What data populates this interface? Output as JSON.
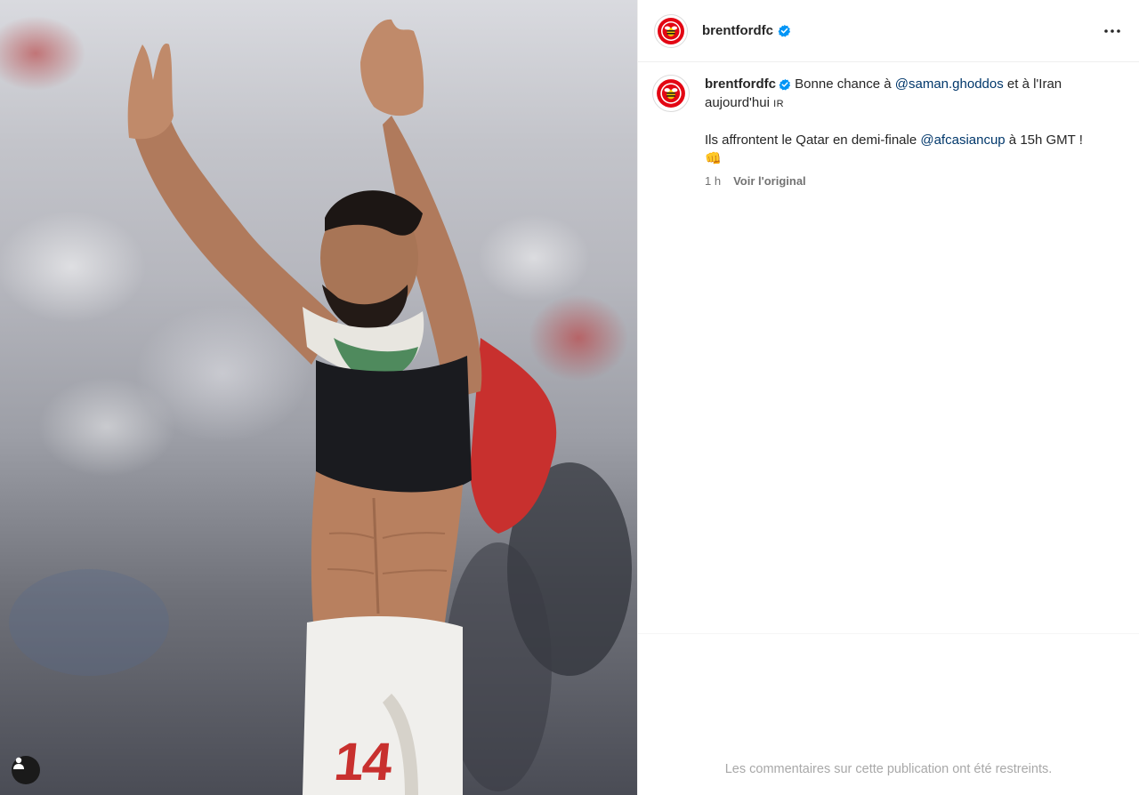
{
  "post": {
    "media_alt": "",
    "jersey_number": "14",
    "author": {
      "username": "brentfordfc",
      "verified": true,
      "avatar_icon": "brentford-bee-crest-icon"
    },
    "more_icon": "more-options-icon",
    "caption": {
      "username": "brentfordfc",
      "text_before": "Bonne chance à ",
      "mention_1": "@saman.ghoddos",
      "text_middle": " et à l'Iran aujourd'hui ",
      "flag": "IR",
      "line2_before": "Ils affrontent le Qatar en demi-finale ",
      "mention_2": "@afcasiancup",
      "line2_after": " à 15h GMT !",
      "emoji": "👊"
    },
    "timestamp": "1 h",
    "see_original": "Voir l'original",
    "comments_restricted": "Les commentaires sur cette publication ont été restreints."
  },
  "colors": {
    "mention": "#00376b",
    "verified": "#0095f6",
    "brand_red": "#e30613",
    "muted": "#737373"
  }
}
